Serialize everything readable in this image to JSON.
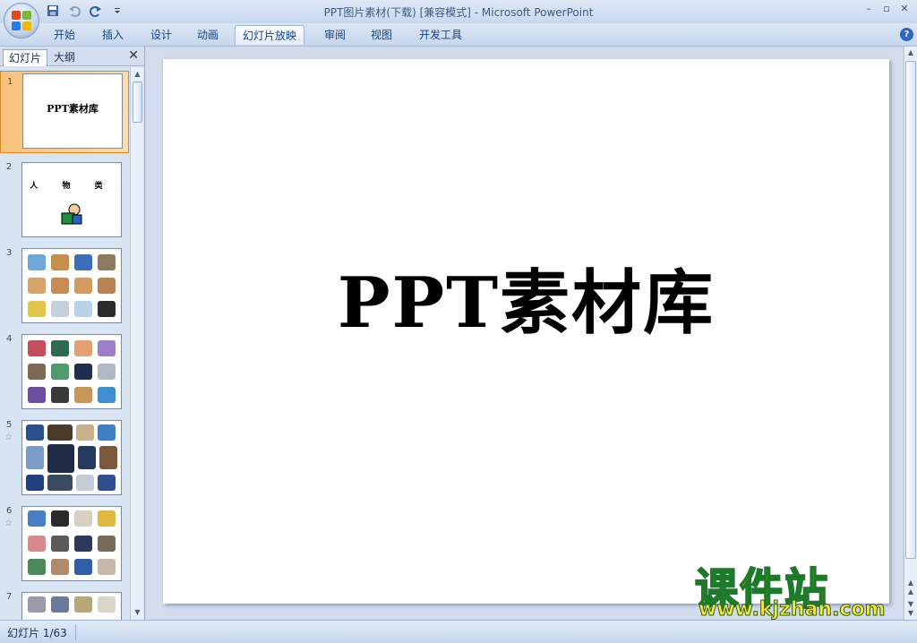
{
  "window": {
    "title": "PPT图片素材(下载) [兼容模式] - Microsoft PowerPoint"
  },
  "quick_access": {
    "icons": [
      "save-icon",
      "undo-icon",
      "redo-icon",
      "customize-icon"
    ]
  },
  "ribbon": {
    "tabs": [
      {
        "label": "开始",
        "active": false
      },
      {
        "label": "插入",
        "active": false
      },
      {
        "label": "设计",
        "active": false
      },
      {
        "label": "动画",
        "active": false
      },
      {
        "label": "幻灯片放映",
        "active": true
      },
      {
        "label": "审阅",
        "active": false
      },
      {
        "label": "视图",
        "active": false
      },
      {
        "label": "开发工具",
        "active": false
      }
    ]
  },
  "panel": {
    "tabs": [
      {
        "label": "幻灯片",
        "active": true
      },
      {
        "label": "大纲",
        "active": false
      }
    ],
    "slides": [
      {
        "num": "1",
        "title": "PPT素材库",
        "selected": true,
        "star": false
      },
      {
        "num": "2",
        "title": "人 物 类",
        "selected": false,
        "star": false
      },
      {
        "num": "3",
        "title": "",
        "selected": false,
        "star": false
      },
      {
        "num": "4",
        "title": "",
        "selected": false,
        "star": false
      },
      {
        "num": "5",
        "title": "",
        "selected": false,
        "star": true
      },
      {
        "num": "6",
        "title": "",
        "selected": false,
        "star": true
      },
      {
        "num": "7",
        "title": "",
        "selected": false,
        "star": false
      }
    ]
  },
  "slide": {
    "title": "PPT素材库"
  },
  "status": {
    "text": "幻灯片 1/63"
  },
  "watermark": {
    "cn": "课件站",
    "url": "www.kjzhan.com"
  },
  "colors": {
    "selected_thumb": "#f7c27c",
    "accent": "#15428b",
    "watermark_yellow": "#f4e600",
    "watermark_green": "#1d7a2a"
  }
}
